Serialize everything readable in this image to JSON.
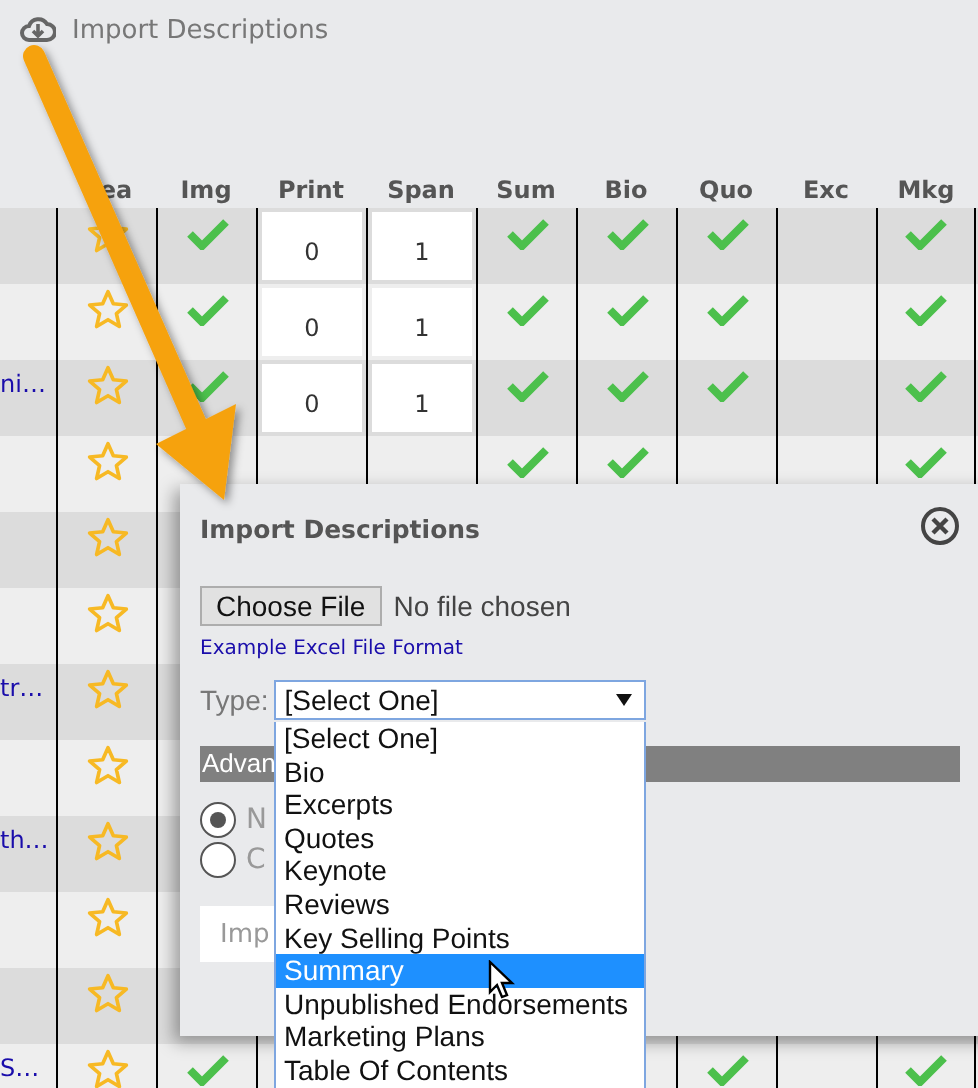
{
  "toolbar": {
    "import_label": "Import Descriptions"
  },
  "table": {
    "columns": [
      "ea",
      "Img",
      "Print",
      "Span",
      "Sum",
      "Bio",
      "Quo",
      "Exc",
      "Mkg"
    ],
    "rows": [
      {
        "starred": false,
        "img": true,
        "print": "0",
        "span": "1",
        "sum": true,
        "bio": true,
        "quo": true,
        "exc": false,
        "mkg": true
      },
      {
        "starred": false,
        "img": true,
        "print": "0",
        "span": "1",
        "sum": true,
        "bio": true,
        "quo": true,
        "exc": false,
        "mkg": true
      },
      {
        "link": "ni…",
        "starred": false,
        "img": true,
        "print": "0",
        "span": "1",
        "sum": true,
        "bio": true,
        "quo": true,
        "exc": false,
        "mkg": true
      },
      {
        "starred": false,
        "sum": true,
        "bio": true,
        "quo": false,
        "exc": false,
        "mkg": true
      },
      {
        "starred": false
      },
      {
        "starred": false
      },
      {
        "link": "tr…",
        "starred": false
      },
      {
        "starred": false
      },
      {
        "link": "th…",
        "starred": false
      },
      {
        "starred": false
      },
      {
        "starred": false
      },
      {
        "link": "S…",
        "starred": false,
        "img": true,
        "quo": true,
        "exc": false,
        "mkg": true
      }
    ]
  },
  "dialog": {
    "title": "Import Descriptions",
    "file_button": "Choose File",
    "file_status": "No file chosen",
    "example_link": "Example Excel File Format",
    "type_label": "Type:",
    "type_value": "[Select One]",
    "type_options": [
      {
        "label": "[Select One]",
        "selected": false
      },
      {
        "label": "Bio",
        "selected": false
      },
      {
        "label": "Excerpts",
        "selected": false
      },
      {
        "label": "Quotes",
        "selected": false
      },
      {
        "label": "Keynote",
        "selected": false
      },
      {
        "label": "Reviews",
        "selected": false
      },
      {
        "label": "Key Selling Points",
        "selected": false
      },
      {
        "label": "Summary",
        "selected": true
      },
      {
        "label": "Unpublished Endorsements",
        "selected": false
      },
      {
        "label": "Marketing Plans",
        "selected": false
      },
      {
        "label": "Table Of Contents",
        "selected": false
      }
    ],
    "advanced_label": "Advan",
    "radios": [
      {
        "label": "N",
        "selected": true
      },
      {
        "label": "C",
        "selected": false
      }
    ],
    "import_button": "Imp"
  }
}
